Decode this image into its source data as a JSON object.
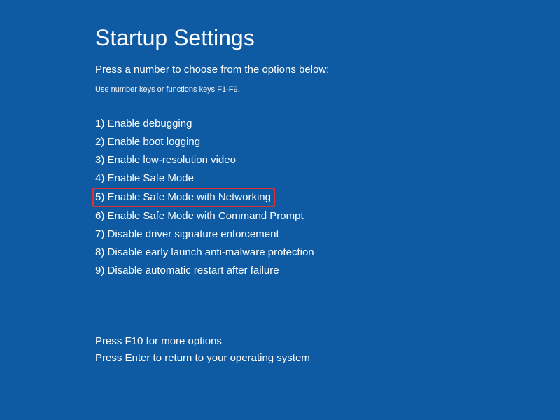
{
  "title": "Startup Settings",
  "subtitle": "Press a number to choose from the options below:",
  "instruction": "Use number keys or functions keys F1-F9.",
  "options": [
    {
      "label": "1) Enable debugging",
      "highlighted": false
    },
    {
      "label": "2) Enable boot logging",
      "highlighted": false
    },
    {
      "label": "3) Enable low-resolution video",
      "highlighted": false
    },
    {
      "label": "4) Enable Safe Mode",
      "highlighted": false
    },
    {
      "label": "5) Enable Safe Mode with Networking",
      "highlighted": true
    },
    {
      "label": "6) Enable Safe Mode with Command Prompt",
      "highlighted": false
    },
    {
      "label": "7) Disable driver signature enforcement",
      "highlighted": false
    },
    {
      "label": "8) Disable early launch anti-malware protection",
      "highlighted": false
    },
    {
      "label": "9) Disable automatic restart after failure",
      "highlighted": false
    }
  ],
  "footer": {
    "line1": "Press F10 for more options",
    "line2": "Press Enter to return to your operating system"
  }
}
